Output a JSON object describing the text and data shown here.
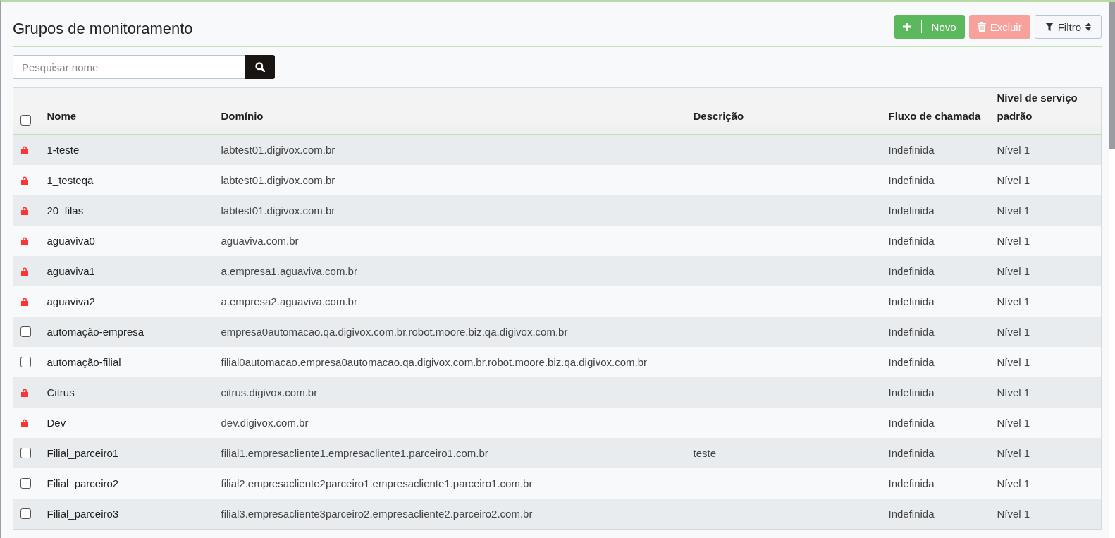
{
  "page": {
    "title": "Grupos de monitoramento"
  },
  "actions": [
    {
      "kind": "new",
      "label": "Novo"
    },
    {
      "kind": "delete",
      "label": "Excluir",
      "disabled": true
    },
    {
      "kind": "filter",
      "label": "Filtro"
    }
  ],
  "search": {
    "placeholder": "Pesquisar nome"
  },
  "table": {
    "select_all": {
      "checked": false
    },
    "columns": [
      "Nome",
      "Domínio",
      "Descrição",
      "Fluxo de chamada",
      "Nível de serviço padrão"
    ],
    "rows": [
      {
        "kind": "locked",
        "cells": [
          "1-teste",
          "labtest01.digivox.com.br",
          "",
          "Indefinida",
          "Nível 1"
        ]
      },
      {
        "kind": "locked",
        "cells": [
          "1_testeqa",
          "labtest01.digivox.com.br",
          "",
          "Indefinida",
          "Nível 1"
        ]
      },
      {
        "kind": "locked",
        "cells": [
          "20_filas",
          "labtest01.digivox.com.br",
          "",
          "Indefinida",
          "Nível 1"
        ]
      },
      {
        "kind": "locked",
        "cells": [
          "aguaviva0",
          "aguaviva.com.br",
          "",
          "Indefinida",
          "Nível 1"
        ]
      },
      {
        "kind": "locked",
        "cells": [
          "aguaviva1",
          "a.empresa1.aguaviva.com.br",
          "",
          "Indefinida",
          "Nível 1"
        ]
      },
      {
        "kind": "locked",
        "cells": [
          "aguaviva2",
          "a.empresa2.aguaviva.com.br",
          "",
          "Indefinida",
          "Nível 1"
        ]
      },
      {
        "kind": "checkbox",
        "checked": false,
        "cells": [
          "automação-empresa",
          "empresa0automacao.qa.digivox.com.br.robot.moore.biz.qa.digivox.com.br",
          "",
          "Indefinida",
          "Nível 1"
        ]
      },
      {
        "kind": "checkbox",
        "checked": false,
        "cells": [
          "automação-filial",
          "filial0automacao.empresa0automacao.qa.digivox.com.br.robot.moore.biz.qa.digivox.com.br",
          "",
          "Indefinida",
          "Nível 1"
        ]
      },
      {
        "kind": "locked",
        "cells": [
          "Citrus",
          "citrus.digivox.com.br",
          "",
          "Indefinida",
          "Nível 1"
        ]
      },
      {
        "kind": "locked",
        "cells": [
          "Dev",
          "dev.digivox.com.br",
          "",
          "Indefinida",
          "Nível 1"
        ]
      },
      {
        "kind": "checkbox",
        "checked": false,
        "cells": [
          "Filial_parceiro1",
          "filial1.empresacliente1.empresacliente1.parceiro1.com.br",
          "teste",
          "Indefinida",
          "Nível 1"
        ]
      },
      {
        "kind": "checkbox",
        "checked": false,
        "cells": [
          "Filial_parceiro2",
          "filial2.empresacliente2parceiro1.empresacliente1.parceiro1.com.br",
          "",
          "Indefinida",
          "Nível 1"
        ]
      },
      {
        "kind": "checkbox",
        "checked": false,
        "cells": [
          "Filial_parceiro3",
          "filial3.empresacliente3parceiro2.empresacliente2.parceiro2.com.br",
          "",
          "Indefinida",
          "Nível 1"
        ]
      }
    ]
  }
}
